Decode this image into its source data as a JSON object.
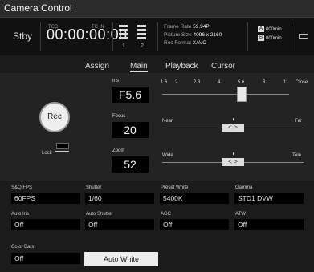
{
  "title": "Camera Control",
  "status": {
    "stby": "Stby",
    "tcg": "TCG",
    "tc_in": "TC IN",
    "timecode": "00:00:00:00",
    "ch1": "1",
    "ch2": "2",
    "frame_rate_label": "Frame Rate",
    "frame_rate": "59.94P",
    "picture_size_label": "Picture Size",
    "picture_size": "4096 x 2160",
    "rec_format_label": "Rec Format",
    "rec_format": "XAVC",
    "media_a_label": "A",
    "media_a": "000min",
    "media_b_label": "B",
    "media_b": "000min"
  },
  "tabs": [
    "Assign",
    "Main",
    "Playback",
    "Cursor"
  ],
  "active_tab": "Main",
  "rec_label": "Rec",
  "lock_label": "Lock",
  "iris": {
    "label": "Iris",
    "value": "F5.6",
    "scale": [
      "1.6",
      "2",
      "2.8",
      "4",
      "5.6",
      "8",
      "11"
    ],
    "close": "Close"
  },
  "focus": {
    "label": "Focus",
    "value": "20",
    "near": "Near",
    "far": "Far",
    "nav": "<  >"
  },
  "zoom": {
    "label": "Zoom",
    "value": "52",
    "wide": "Wide",
    "tele": "Tele",
    "nav": "<  >"
  },
  "cells_row1": [
    {
      "label": "S&Q FPS",
      "value": "60FPS"
    },
    {
      "label": "Shutter",
      "value": "1/60"
    },
    {
      "label": "Preset White",
      "value": "5400K"
    },
    {
      "label": "Gamma",
      "value": "STD1 DVW"
    }
  ],
  "cells_row2": [
    {
      "label": "Auto Iris",
      "value": "Off"
    },
    {
      "label": "Auto Shutter",
      "value": "Off"
    },
    {
      "label": "AGC",
      "value": "Off"
    },
    {
      "label": "ATW",
      "value": "Off"
    }
  ],
  "color_bars": {
    "label": "Color Bars",
    "value": "Off"
  },
  "auto_white": "Auto White"
}
